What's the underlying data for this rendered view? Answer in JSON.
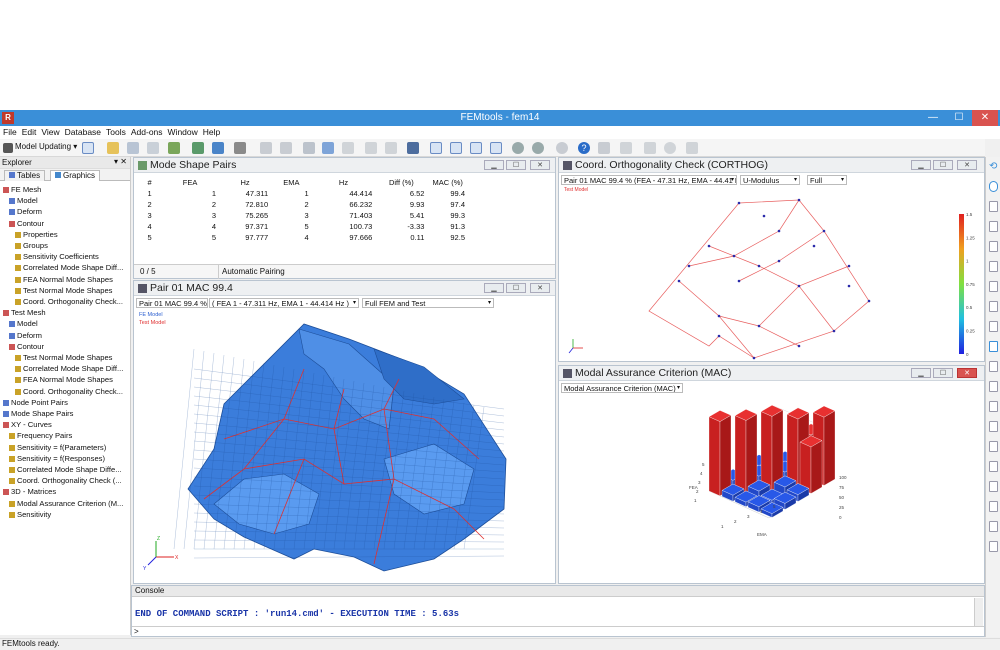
{
  "window": {
    "title": "FEMtools - fem14",
    "icon": "R",
    "minimize": "—",
    "maximize": "☐",
    "close": "✕"
  },
  "menu": [
    "File",
    "Edit",
    "View",
    "Database",
    "Tools",
    "Add-ons",
    "Window",
    "Help"
  ],
  "toolbar": {
    "module_label": "Model Updating"
  },
  "explorer": {
    "title": "Explorer",
    "tabs": [
      "Tables",
      "Graphics"
    ],
    "items": [
      {
        "label": "FE Mesh",
        "level": 0,
        "color": "#c55"
      },
      {
        "label": "Model",
        "level": 1,
        "color": "#5577cc"
      },
      {
        "label": "Deform",
        "level": 1,
        "color": "#5577cc"
      },
      {
        "label": "Contour",
        "level": 1,
        "color": "#c55"
      },
      {
        "label": "Properties",
        "level": 2,
        "color": "#c9a227"
      },
      {
        "label": "Groups",
        "level": 2,
        "color": "#c9a227"
      },
      {
        "label": "Sensitivity Coefficients",
        "level": 2,
        "color": "#c9a227"
      },
      {
        "label": "Correlated Mode Shape Diff...",
        "level": 2,
        "color": "#c9a227"
      },
      {
        "label": "FEA Normal Mode Shapes",
        "level": 2,
        "color": "#c9a227"
      },
      {
        "label": "Test Normal Mode Shapes",
        "level": 2,
        "color": "#c9a227"
      },
      {
        "label": "Coord. Orthogonality Check...",
        "level": 2,
        "color": "#c9a227"
      },
      {
        "label": "Test Mesh",
        "level": 0,
        "color": "#c55"
      },
      {
        "label": "Model",
        "level": 1,
        "color": "#5577cc"
      },
      {
        "label": "Deform",
        "level": 1,
        "color": "#5577cc"
      },
      {
        "label": "Contour",
        "level": 1,
        "color": "#c55"
      },
      {
        "label": "Test Normal Mode Shapes",
        "level": 2,
        "color": "#c9a227"
      },
      {
        "label": "Correlated Mode Shape Diff...",
        "level": 2,
        "color": "#c9a227"
      },
      {
        "label": "FEA Normal Mode Shapes",
        "level": 2,
        "color": "#c9a227"
      },
      {
        "label": "Coord. Orthogonality Check...",
        "level": 2,
        "color": "#c9a227"
      },
      {
        "label": "Node Point Pairs",
        "level": 0,
        "color": "#5577cc"
      },
      {
        "label": "Mode Shape Pairs",
        "level": 0,
        "color": "#5577cc"
      },
      {
        "label": "XY - Curves",
        "level": 0,
        "color": "#c55"
      },
      {
        "label": "Frequency Pairs",
        "level": 1,
        "color": "#c9a227"
      },
      {
        "label": "Sensitivity = f(Parameters)",
        "level": 1,
        "color": "#c9a227"
      },
      {
        "label": "Sensitivity = f(Responses)",
        "level": 1,
        "color": "#c9a227"
      },
      {
        "label": "Correlated Mode Shape Diffe...",
        "level": 1,
        "color": "#c9a227"
      },
      {
        "label": "Coord. Orthogonality Check (...",
        "level": 1,
        "color": "#c9a227"
      },
      {
        "label": "3D - Matrices",
        "level": 0,
        "color": "#c55"
      },
      {
        "label": "Modal Assurance Criterion (M...",
        "level": 1,
        "color": "#c9a227"
      },
      {
        "label": "Sensitivity",
        "level": 1,
        "color": "#c9a227"
      }
    ]
  },
  "mode_pairs": {
    "title": "Mode Shape Pairs",
    "columns": [
      "#",
      "FEA",
      "Hz",
      "EMA",
      "Hz",
      "Diff (%)",
      "MAC (%)"
    ],
    "rows": [
      [
        "1",
        "1",
        "47.311",
        "1",
        "44.414",
        "6.52",
        "99.4"
      ],
      [
        "2",
        "2",
        "72.810",
        "2",
        "66.232",
        "9.93",
        "97.4"
      ],
      [
        "3",
        "3",
        "75.265",
        "3",
        "71.403",
        "5.41",
        "99.3"
      ],
      [
        "4",
        "4",
        "97.371",
        "5",
        "100.73",
        "-3.33",
        "91.3"
      ],
      [
        "5",
        "5",
        "97.777",
        "4",
        "97.666",
        "0.11",
        "92.5"
      ]
    ],
    "footer_count": "0 / 5",
    "footer_mode": "Automatic Pairing"
  },
  "pair_view": {
    "title": "Pair 01 MAC  99.4",
    "dd_pair": "Pair 01 MAC  99.4 %",
    "dd_detail": "( FEA 1 - 47.311 Hz,  EMA 1 - 44.414 Hz )",
    "dd_display": "Full FEM and Test",
    "legend_fe": "FE Model",
    "legend_test": "Test Model",
    "axis_x": "X",
    "axis_y": "Y",
    "axis_z": "Z"
  },
  "corthog": {
    "title": "Coord. Orthogonality Check (CORTHOG)",
    "dd_pair": "Pair 01 MAC 99.4 % (FEA - 47.31 Hz, EMA - 44.41 Hz)",
    "dd_mode": "U-Modulus",
    "dd_range": "Full",
    "legend_test": "Test Model",
    "colorbar_ticks": [
      "1.5",
      "1.25",
      "1",
      "0.75",
      "0.5",
      "0.25",
      "0"
    ]
  },
  "mac": {
    "title": "Modal Assurance Criterion (MAC)",
    "dd": "Modal Assurance Criterion (MAC)",
    "xlabel": "EMA",
    "ylabel": "FEA",
    "z_ticks": [
      "100",
      "75",
      "50",
      "25",
      "0"
    ],
    "fea_ticks": [
      "5",
      "4",
      "3",
      "2",
      "1"
    ],
    "ema_ticks": [
      "1",
      "2",
      "3",
      "4",
      "5"
    ]
  },
  "console": {
    "title": "Console",
    "line": "END OF COMMAND SCRIPT : 'run14.cmd' - EXECUTION TIME : 5.63s",
    "prompt": ">"
  },
  "status": "FEMtools ready.",
  "colors": {
    "title_bar": "#3a8fd8",
    "mesh_blue": "#3b7ddb",
    "test_red": "#e03030",
    "console_text": "#1a35a8"
  }
}
